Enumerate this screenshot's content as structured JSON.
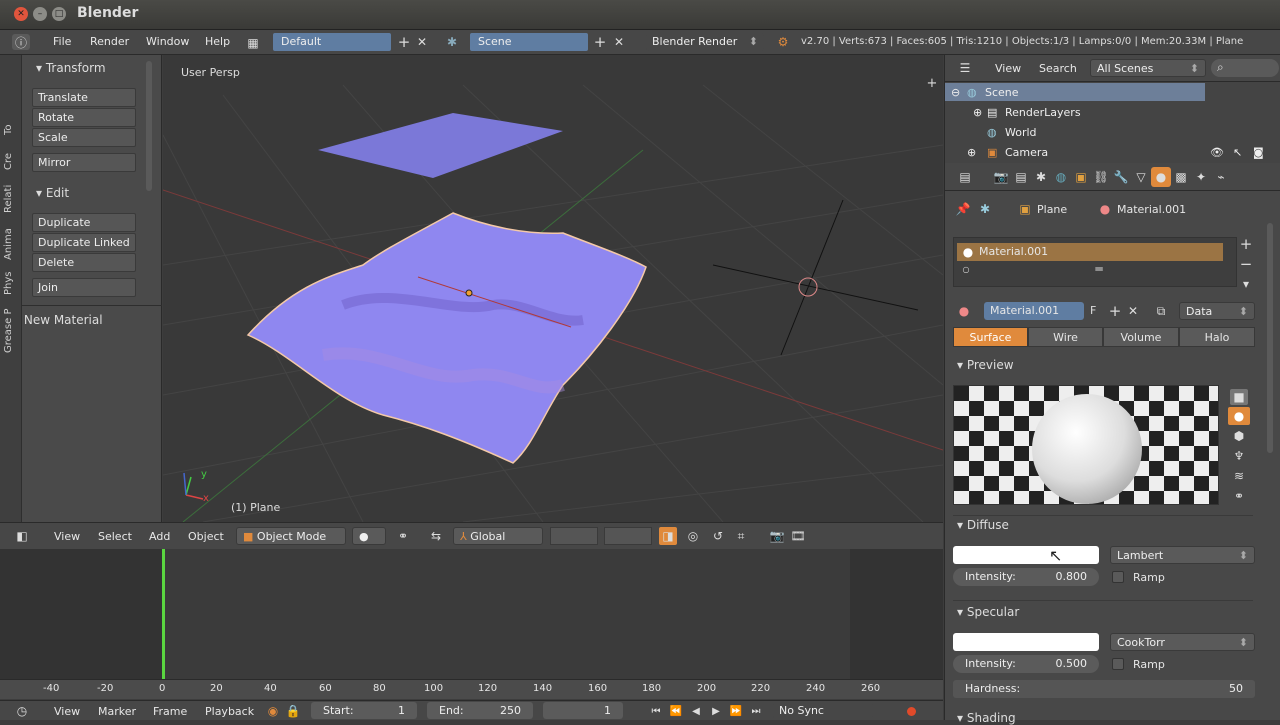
{
  "window": {
    "title": "Blender"
  },
  "infobar": {
    "menus": [
      "File",
      "Render",
      "Window",
      "Help"
    ],
    "layout": "Default",
    "scene": "Scene",
    "engine": "Blender Render",
    "stats": "v2.70 | Verts:673 | Faces:605 | Tris:1210 | Objects:1/3 | Lamps:0/0 | Mem:20.33M | Plane"
  },
  "toolshelf": {
    "tabs": [
      "To",
      "Cre",
      "Relati",
      "Anima",
      "Phys",
      "Grease P"
    ],
    "transform_header": "Transform",
    "transform_buttons": [
      "Translate",
      "Rotate",
      "Scale",
      "Mirror"
    ],
    "edit_header": "Edit",
    "edit_buttons": [
      "Duplicate",
      "Duplicate Linked",
      "Delete",
      "Join"
    ],
    "new_material": "New Material"
  },
  "viewport": {
    "view_label": "User Persp",
    "object_label": "(1) Plane",
    "axis_x": "x",
    "axis_y": "y"
  },
  "viewport_header": {
    "menus": [
      "View",
      "Select",
      "Add",
      "Object"
    ],
    "mode": "Object Mode",
    "orientation": "Global"
  },
  "timeline": {
    "ruler": [
      "-40",
      "-20",
      "0",
      "20",
      "40",
      "60",
      "80",
      "100",
      "120",
      "140",
      "160",
      "180",
      "200",
      "220",
      "240",
      "260"
    ],
    "menus": [
      "View",
      "Marker",
      "Frame",
      "Playback"
    ],
    "start_label": "Start:",
    "start_value": "1",
    "end_label": "End:",
    "end_value": "250",
    "current_frame": "1",
    "sync": "No Sync"
  },
  "outliner": {
    "menus": [
      "View",
      "Search"
    ],
    "filter": "All Scenes",
    "items": [
      "Scene",
      "RenderLayers",
      "World",
      "Camera"
    ]
  },
  "properties": {
    "breadcrumb_object": "Plane",
    "breadcrumb_material": "Material.001",
    "slot_name": "Material.001",
    "material_field": "Material.001",
    "fake_user": "F",
    "link": "Data",
    "tabs": [
      "Surface",
      "Wire",
      "Volume",
      "Halo"
    ],
    "preview_header": "Preview",
    "diffuse_header": "Diffuse",
    "diffuse_shader": "Lambert",
    "diffuse_intensity_label": "Intensity:",
    "diffuse_intensity_value": "0.800",
    "ramp_label": "Ramp",
    "specular_header": "Specular",
    "specular_shader": "CookTorr",
    "specular_intensity_label": "Intensity:",
    "specular_intensity_value": "0.500",
    "hardness_label": "Hardness:",
    "hardness_value": "50",
    "shading_header": "Shading"
  },
  "colors": {
    "accent_orange": "#e08a3c",
    "selection_blue": "#5f7da2",
    "mesh": "#8f87f0"
  }
}
